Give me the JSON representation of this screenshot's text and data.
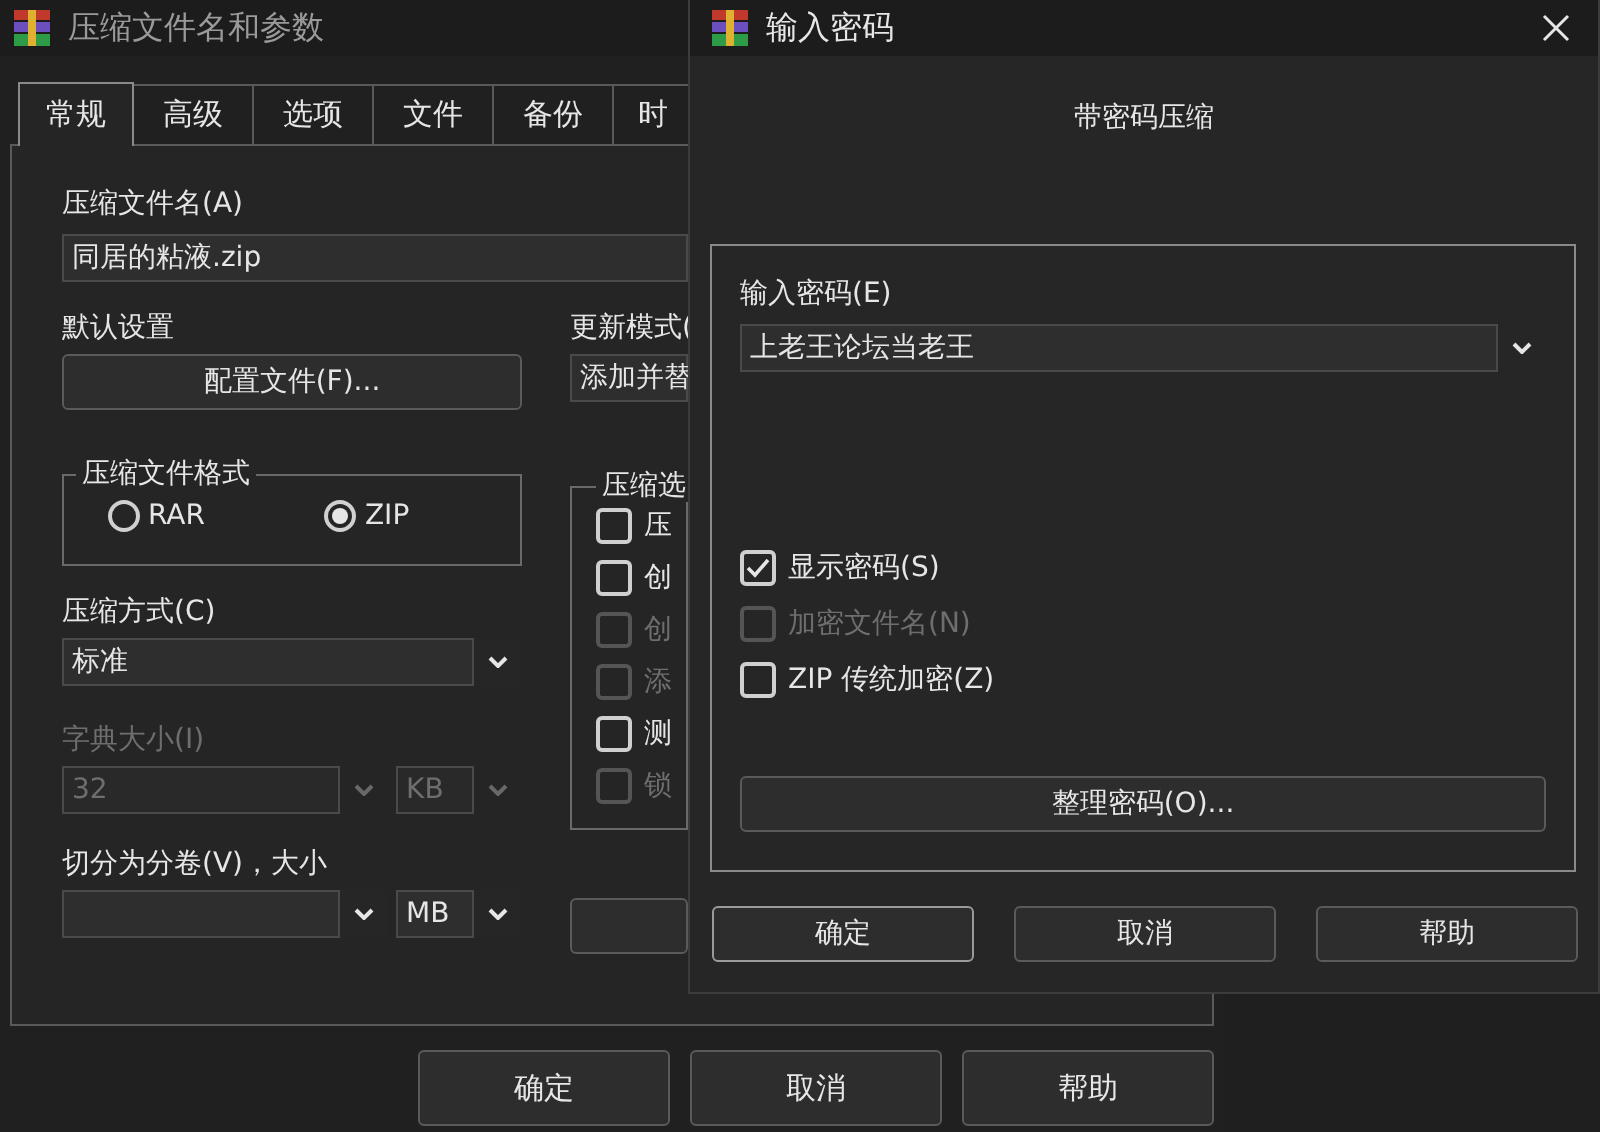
{
  "back_window": {
    "title": "压缩文件名和参数",
    "tabs": [
      {
        "label": "常规",
        "selected": true
      },
      {
        "label": "高级",
        "selected": false
      },
      {
        "label": "选项",
        "selected": false
      },
      {
        "label": "文件",
        "selected": false
      },
      {
        "label": "备份",
        "selected": false
      },
      {
        "label": "时",
        "selected": false
      }
    ],
    "archive_name": {
      "label": "压缩文件名(A)",
      "value": "同居的粘液.zip"
    },
    "default_settings": {
      "label": "默认设置",
      "button": "配置文件(F)..."
    },
    "update_mode": {
      "label": "更新模式(",
      "value": "添加并替"
    },
    "archive_format": {
      "label": "压缩文件格式",
      "options": [
        {
          "label": "RAR",
          "selected": false
        },
        {
          "label": "ZIP",
          "selected": true
        }
      ]
    },
    "archive_options": {
      "label": "压缩选",
      "items": [
        {
          "label": "压",
          "checked": false,
          "disabled": false
        },
        {
          "label": "创",
          "checked": false,
          "disabled": false
        },
        {
          "label": "创",
          "checked": false,
          "disabled": true
        },
        {
          "label": "添",
          "checked": false,
          "disabled": true
        },
        {
          "label": "测",
          "checked": false,
          "disabled": false
        },
        {
          "label": "锁",
          "checked": false,
          "disabled": true
        }
      ]
    },
    "compression_method": {
      "label": "压缩方式(C)",
      "value": "标准"
    },
    "dictionary_size": {
      "label": "字典大小(I)",
      "value": "32",
      "unit": "KB",
      "disabled": true
    },
    "split_volumes": {
      "label": "切分为分卷(V)，大小",
      "unit": "MB"
    },
    "buttons": [
      "确定",
      "取消",
      "帮助"
    ]
  },
  "dialog": {
    "title": "输入密码",
    "heading": "带密码压缩",
    "password": {
      "label": "输入密码(E)",
      "value": "上老王论坛当老王"
    },
    "options": [
      {
        "label": "显示密码(S)",
        "checked": true,
        "disabled": false
      },
      {
        "label": "加密文件名(N)",
        "checked": false,
        "disabled": true
      },
      {
        "label": "ZIP 传统加密(Z)",
        "checked": false,
        "disabled": false
      }
    ],
    "organize_button": "整理密码(O)...",
    "buttons": [
      "确定",
      "取消",
      "帮助"
    ]
  }
}
